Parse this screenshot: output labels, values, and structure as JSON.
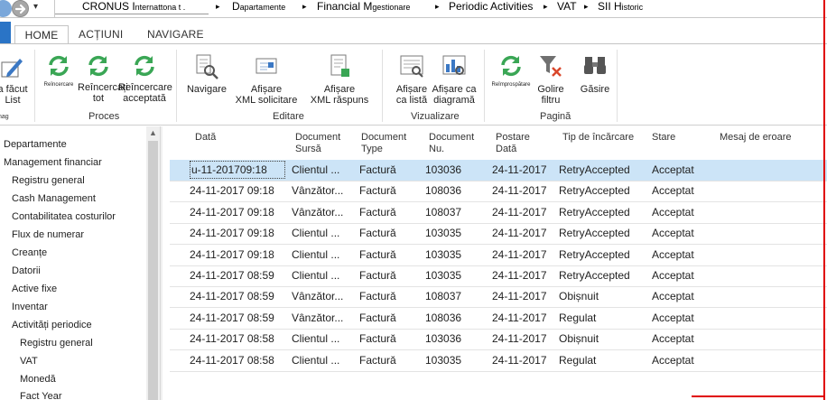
{
  "address": {
    "nav_dropdown": "▾",
    "crumbs": [
      {
        "main": "CRONUS I",
        "small": "nternattona t ."
      },
      {
        "main": "D",
        "small": "apartamente"
      },
      {
        "main": "Financial M",
        "small": "gestionare"
      },
      {
        "main": "Periodic Activities",
        "small": ""
      },
      {
        "main": "VAT",
        "small": ""
      },
      {
        "main": "SII H",
        "small": "istoric"
      }
    ],
    "separator": "▸"
  },
  "tabs": {
    "home": "HOME",
    "actions": "ACȚIUNI",
    "navigate": "NAVIGARE"
  },
  "ribbon": {
    "partial_button": {
      "line1": "a făcut",
      "line2": "List"
    },
    "partial_group": "nag",
    "proces": {
      "label": "Proces",
      "btn1": "Reîncercare",
      "btn2_l1": "Reîncercați",
      "btn2_l2": "tot",
      "btn3_l1": "Reîncercare",
      "btn3_l2": "acceptată"
    },
    "editare": {
      "label": "Editare",
      "btn1": "Navigare",
      "btn2_l1": "Afișare",
      "btn2_l2": "XML solicitare",
      "btn3_l1": "Afișare",
      "btn3_l2": "XML răspuns"
    },
    "vizualizare": {
      "label": "Vizualizare",
      "btn1_l1": "Afișare",
      "btn1_l2": "ca listă",
      "btn2_l1": "Afișare ca",
      "btn2_l2": "diagramă"
    },
    "pagina": {
      "label": "Pagină",
      "btn1": "Reîmprospătare",
      "btn2_l1": "Golire",
      "btn2_l2": "filtru",
      "btn3": "Găsire"
    }
  },
  "nav": {
    "items": [
      "Departamente",
      "Management financiar",
      "Registru general",
      "Cash Management",
      "Contabilitatea costurilor",
      "Flux de numerar",
      "Creanțe",
      "Datorii",
      "Active fixe",
      "Inventar",
      "Activități periodice",
      "Registru general",
      "VAT",
      "Monedă",
      "Fact Year"
    ]
  },
  "grid": {
    "headers": {
      "date": "Dată",
      "src_l1": "Document",
      "src_l2": "Sursă",
      "type_l1": "Document",
      "type_l2": "Type",
      "no_l1": "Document",
      "no_l2": "Nu.",
      "post_l1": "Postare",
      "post_l2": "Dată",
      "upload": "Tip de încărcare",
      "status": "Stare",
      "error": "Mesaj de eroare"
    },
    "rows": [
      {
        "date": "u-11-201709:18",
        "source": "Clientul ...",
        "type": "Factură",
        "no": "103036",
        "posting": "24-11-2017",
        "upload": "RetryAccepted",
        "status": "Acceptat"
      },
      {
        "date": "24-11-2017 09:18",
        "source": "Vânzător...",
        "type": "Factură",
        "no": "108036",
        "posting": "24-11-2017",
        "upload": "RetryAccepted",
        "status": "Acceptat"
      },
      {
        "date": "24-11-2017 09:18",
        "source": "Vânzător...",
        "type": "Factură",
        "no": "108037",
        "posting": "24-11-2017",
        "upload": "RetryAccepted",
        "status": "Acceptat"
      },
      {
        "date": "24-11-2017 09:18",
        "source": "Clientul ...",
        "type": "Factură",
        "no": "103035",
        "posting": "24-11-2017",
        "upload": "RetryAccepted",
        "status": "Acceptat"
      },
      {
        "date": "24-11-2017 09:18",
        "source": "Clientul ...",
        "type": "Factură",
        "no": "103035",
        "posting": "24-11-2017",
        "upload": "RetryAccepted",
        "status": "Acceptat"
      },
      {
        "date": "24-11-2017 08:59",
        "source": "Clientul ...",
        "type": "Factură",
        "no": "103035",
        "posting": "24-11-2017",
        "upload": "RetryAccepted",
        "status": "Acceptat"
      },
      {
        "date": "24-11-2017 08:59",
        "source": "Vânzător...",
        "type": "Factură",
        "no": "108037",
        "posting": "24-11-2017",
        "upload": "Obișnuit",
        "status": "Acceptat"
      },
      {
        "date": "24-11-2017 08:59",
        "source": "Vânzător...",
        "type": "Factură",
        "no": "108036",
        "posting": "24-11-2017",
        "upload": "Regulat",
        "status": "Acceptat"
      },
      {
        "date": "24-11-2017 08:58",
        "source": "Clientul ...",
        "type": "Factură",
        "no": "103036",
        "posting": "24-11-2017",
        "upload": "Obișnuit",
        "status": "Acceptat"
      },
      {
        "date": "24-11-2017 08:58",
        "source": "Clientul ...",
        "type": "Factură",
        "no": "103035",
        "posting": "24-11-2017",
        "upload": "Regulat",
        "status": "Acceptat"
      }
    ]
  },
  "colors": {
    "accent": "#2a74c6",
    "selection": "#cce4f7",
    "annotation": "#e00000",
    "icon_green": "#3aa655"
  }
}
